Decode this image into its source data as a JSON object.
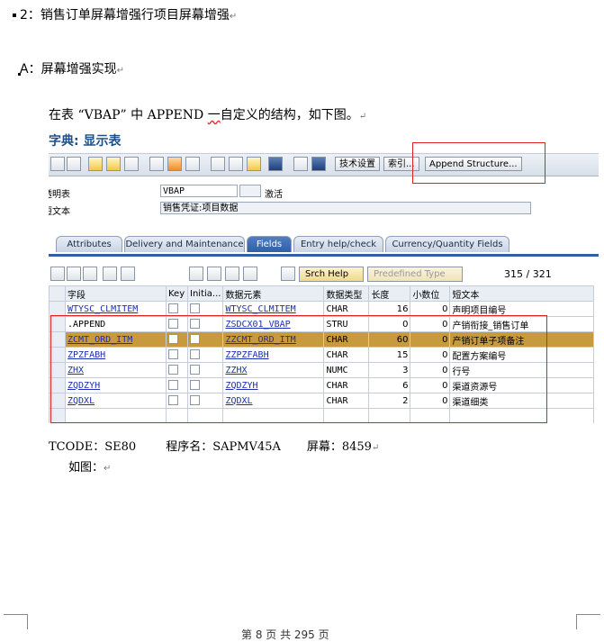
{
  "heading": "2：销售订单屏幕增强行项目屏幕增强",
  "subheading": "A：屏幕增强实现",
  "paragraph": {
    "pre": "在表 “VBAP” 中 APPEND ",
    "ul": "一",
    "post": "自定义的结构，如下图。"
  },
  "sap": {
    "title": "字典: 显示表",
    "toolbar": {
      "tech_settings": "技术设置",
      "index": "索引...",
      "append": "Append Structure..."
    },
    "table_label": "透明表",
    "table_value": "VBAP",
    "status": "激活",
    "short_desc_label": "短文本",
    "short_desc_value": "销售凭证:项目数据",
    "tabs": [
      "Attributes",
      "Delivery and Maintenance",
      "Fields",
      "Entry help/check",
      "Currency/Quantity Fields"
    ],
    "active_tab": "Fields",
    "srch_help": "Srch Help",
    "predefined_type": "Predefined Type",
    "pager_current": "315",
    "pager_sep": "/",
    "pager_total": "321",
    "columns": [
      "字段",
      "Key",
      "Initia...",
      "数据元素",
      "数据类型",
      "长度",
      "小数位",
      "短文本"
    ],
    "rows": [
      {
        "field": "WTYSC_CLMITEM",
        "element": "WTYSC_CLMITEM",
        "type": "CHAR",
        "length": "16",
        "dec": "0",
        "desc": "声明项目编号",
        "link": true,
        "hl": false
      },
      {
        "field": ".APPEND",
        "element": "ZSDCX01_VBAP",
        "type": "STRU",
        "length": "0",
        "dec": "0",
        "desc": "产销衔接_销售订单",
        "link": false,
        "hl": false
      },
      {
        "field": "ZCMT_ORD_ITM",
        "element": "ZZCMT_ORD_ITM",
        "type": "CHAR",
        "length": "60",
        "dec": "0",
        "desc": "产销订单子项备注",
        "link": true,
        "hl": true
      },
      {
        "field": "ZPZFABH",
        "element": "ZZPZFABH",
        "type": "CHAR",
        "length": "15",
        "dec": "0",
        "desc": "配置方案编号",
        "link": true,
        "hl": false
      },
      {
        "field": "ZHX",
        "element": "ZZHX",
        "type": "NUMC",
        "length": "3",
        "dec": "0",
        "desc": "行号",
        "link": true,
        "hl": false
      },
      {
        "field": "ZQDZYH",
        "element": "ZQDZYH",
        "type": "CHAR",
        "length": "6",
        "dec": "0",
        "desc": "渠道资源号",
        "link": true,
        "hl": false
      },
      {
        "field": "ZQDXL",
        "element": "ZQDXL",
        "type": "CHAR",
        "length": "2",
        "dec": "0",
        "desc": "渠道细类",
        "link": true,
        "hl": false
      }
    ]
  },
  "footer": {
    "tcode": "TCODE：SE80",
    "program": "程序名：SAPMV45A",
    "screen": "屏幕：8459"
  },
  "figure_note": "如图：",
  "page_number": "第 8 页 共 295 页"
}
